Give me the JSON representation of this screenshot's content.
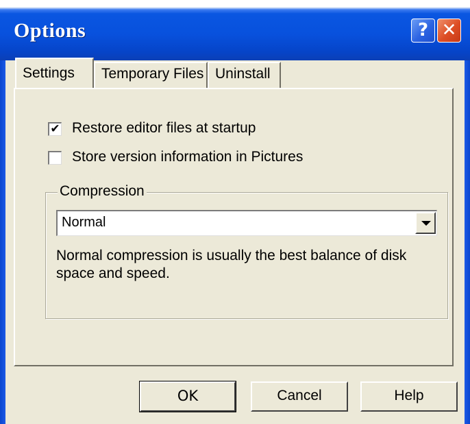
{
  "window": {
    "title": "Options",
    "help_button": "?",
    "close_button": "✕"
  },
  "tabs": [
    {
      "label": "Settings",
      "selected": true
    },
    {
      "label": "Temporary Files",
      "selected": false
    },
    {
      "label": "Uninstall",
      "selected": false
    }
  ],
  "settings": {
    "restore_editor_files": {
      "label": "Restore editor files at startup",
      "checked": true,
      "mark": "✔"
    },
    "store_version_info": {
      "label": "Store version information in Pictures",
      "checked": false,
      "mark": ""
    }
  },
  "compression": {
    "group_label": "Compression",
    "selected_value": "Normal",
    "description": "Normal compression is usually the best balance of disk space and speed."
  },
  "buttons": {
    "ok": "OK",
    "cancel": "Cancel",
    "help": "Help"
  },
  "colors": {
    "title_bar": "#0851dd",
    "face": "#ece9d8",
    "close_button": "#dd4d24"
  }
}
